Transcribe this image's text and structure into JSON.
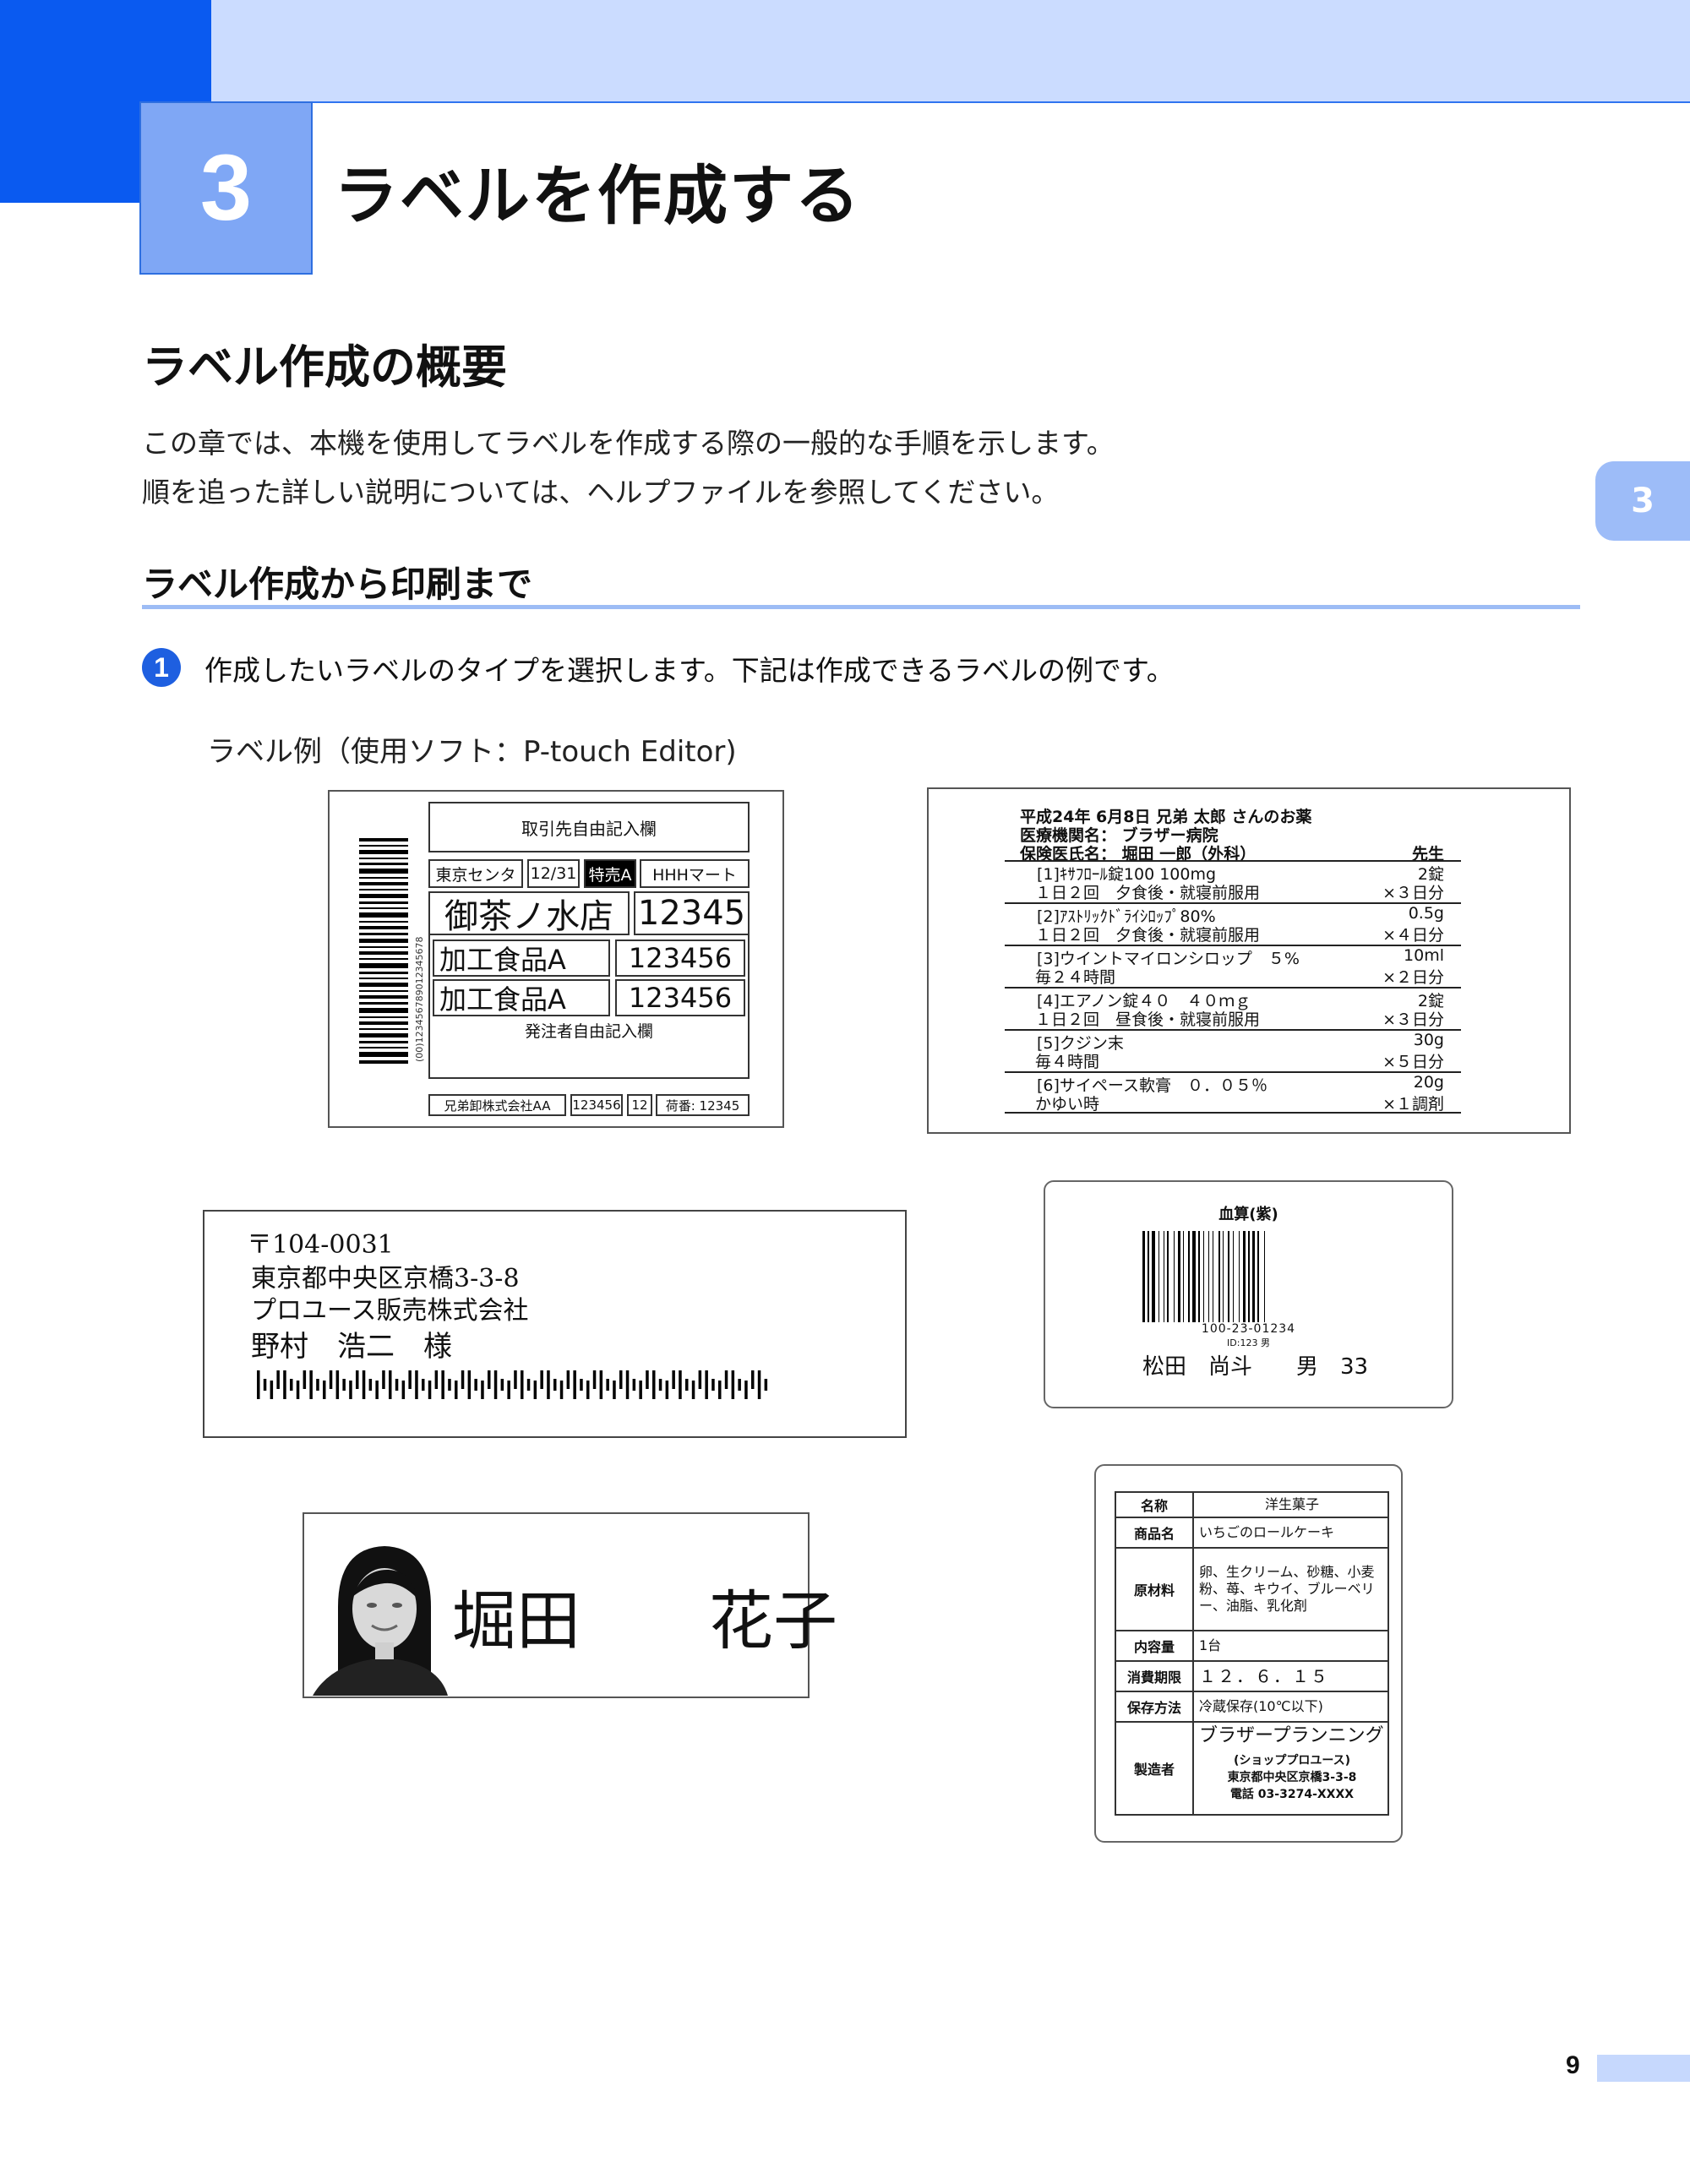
{
  "chapter": {
    "number": "3",
    "title": "ラベルを作成する",
    "side_tab": "3"
  },
  "section": {
    "heading": "ラベル作成の概要",
    "intro": [
      "この章では、本機を使用してラベルを作成する際の一般的な手順を示します。",
      "順を追った詳しい説明については、ヘルプファイルを参照してください。"
    ]
  },
  "subsection": {
    "heading": "ラベル作成から印刷まで"
  },
  "step1": {
    "number": "1",
    "text": "作成したいラベルのタイプを選択します。下記は作成できるラベルの例です。"
  },
  "caption": "ラベル例（使用ソフト：P-touch Editor)",
  "label_shipping": {
    "header": "取引先自由記入欄",
    "row1": [
      "東京センタ",
      "12/31",
      "特売A",
      "HHHマート"
    ],
    "store": "御茶ノ水店",
    "store_no": "12345",
    "item1": "加工食品A",
    "item1_no": "123456",
    "item2": "加工食品A",
    "item2_no": "123456",
    "footer_note": "発注者自由記入欄",
    "bottom": [
      "兄弟卸株式会社AA",
      "123456",
      "12",
      "荷番: 12345"
    ],
    "barcode_text": "(00)123456789012345678"
  },
  "label_medicine": {
    "header1": "平成24年 6月8日 兄弟 太郎 さんのお薬",
    "header2": "医療機関名： ブラザー病院",
    "header3": "保険医氏名： 堀田 一郎（外科）",
    "header3_right": "先生",
    "items": [
      {
        "name": "[1]ｷｻﾌﾛｰﾙ錠100 100mg",
        "qty": "2錠",
        "usage": "１日２回　夕食後・就寝前服用",
        "days": "×３日分"
      },
      {
        "name": "[2]ｱｽﾄﾘｯｸﾄﾞﾗｲｼﾛｯﾌﾟ80%",
        "qty": "0.5g",
        "usage": "１日２回　夕食後・就寝前服用",
        "days": "×４日分"
      },
      {
        "name": "[3]ウイントマイロンシロップ　５%",
        "qty": "10ml",
        "usage": "毎２４時間",
        "days": "×２日分"
      },
      {
        "name": "[4]エアノン錠４０　４０ｍｇ",
        "qty": "2錠",
        "usage": "１日２回　昼食後・就寝前服用",
        "days": "×３日分"
      },
      {
        "name": "[5]クジン末",
        "qty": "30g",
        "usage": "毎４時間",
        "days": "×５日分"
      },
      {
        "name": "[6]サイペース軟膏　０．０５％",
        "qty": "20g",
        "usage": "かゆい時",
        "days": "×１調剤"
      }
    ]
  },
  "label_address": {
    "postal": "〒104-0031",
    "address": "東京都中央区京橋3-3-8",
    "company": "プロユース販売株式会社",
    "name": "野村　浩二　様"
  },
  "label_blood": {
    "title": "血算(紫)",
    "code": "100-23-01234",
    "id_line": "ID:123 男",
    "patient": "松田　尚斗　　男　33"
  },
  "label_name": {
    "name": "堀田　　花子"
  },
  "label_food": {
    "rows": [
      {
        "k": "名称",
        "v": "洋生菓子"
      },
      {
        "k": "商品名",
        "v": "いちごのロールケーキ"
      },
      {
        "k": "原材料",
        "v": "卵、生クリーム、砂糖、小麦粉、苺、キウイ、ブルーベリー、油脂、乳化剤"
      },
      {
        "k": "内容量",
        "v": "1台"
      },
      {
        "k": "消費期限",
        "v": "１２．６．１５"
      },
      {
        "k": "保存方法",
        "v": "冷蔵保存(10℃以下)"
      },
      {
        "k": "製造者",
        "v": "ブラザープランニング"
      }
    ],
    "maker_sub": "(ショッププロユース)",
    "maker_addr": "東京都中央区京橋3-3-8",
    "maker_tel": "電話 03-3274-XXXX"
  },
  "page_number": "9"
}
